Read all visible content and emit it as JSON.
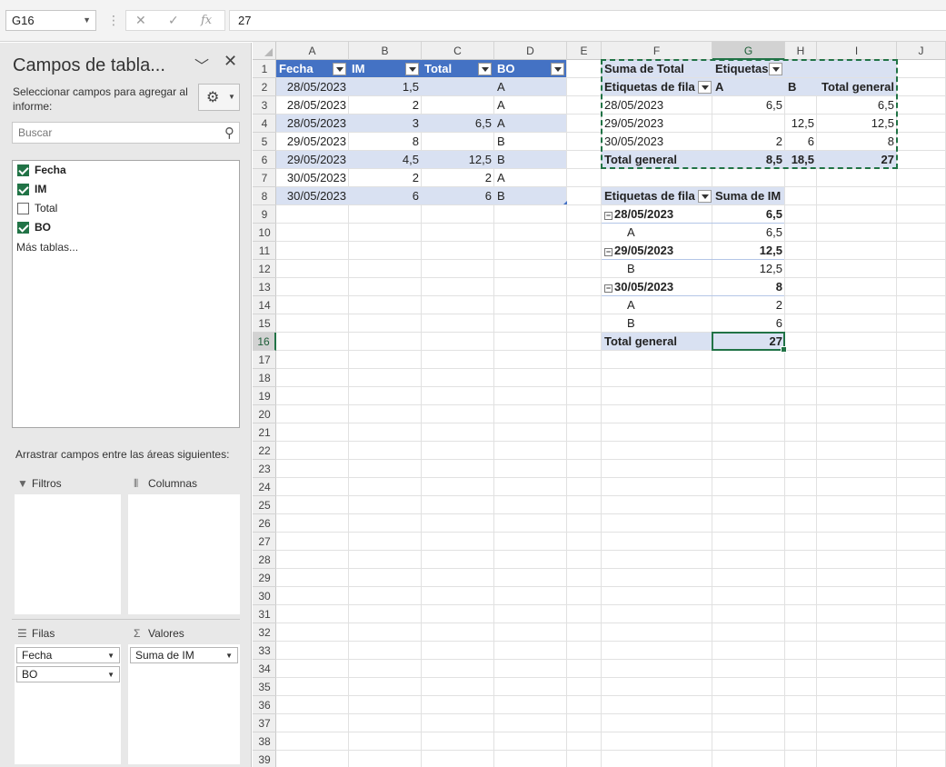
{
  "formula_bar": {
    "name_box": "G16",
    "formula": "27",
    "fx": "fx"
  },
  "pane": {
    "title": "Campos de tabla...",
    "subtitle": "Seleccionar campos para agregar al informe:",
    "search_placeholder": "Buscar",
    "fields": [
      {
        "label": "Fecha",
        "checked": true
      },
      {
        "label": "IM",
        "checked": true
      },
      {
        "label": "Total",
        "checked": false
      },
      {
        "label": "BO",
        "checked": true
      }
    ],
    "more_tables": "Más tablas...",
    "drag_hint": "Arrastrar campos entre las áreas siguientes:",
    "areas": {
      "filters": "Filtros",
      "columns": "Columnas",
      "rows": "Filas",
      "values": "Valores"
    },
    "row_fields": [
      "Fecha",
      "BO"
    ],
    "value_fields": [
      "Suma de IM"
    ]
  },
  "grid": {
    "columns": [
      "A",
      "B",
      "C",
      "D",
      "E",
      "F",
      "G",
      "H",
      "I",
      "J"
    ],
    "rows": [
      "1",
      "2",
      "3",
      "4",
      "5",
      "6",
      "7",
      "8",
      "9",
      "10",
      "11",
      "12",
      "13",
      "14",
      "15",
      "16",
      "17",
      "18",
      "19",
      "20",
      "21",
      "22",
      "23",
      "24",
      "25",
      "26",
      "27",
      "28",
      "29",
      "30",
      "31",
      "32",
      "33",
      "34",
      "35",
      "36",
      "37",
      "38",
      "39"
    ],
    "selected_column": "G",
    "selected_row": "16"
  },
  "source_table": {
    "headers": [
      "Fecha",
      "IM",
      "Total",
      "BO"
    ],
    "rows": [
      [
        "28/05/2023",
        "1,5",
        "",
        "A"
      ],
      [
        "28/05/2023",
        "2",
        "",
        "A"
      ],
      [
        "28/05/2023",
        "3",
        "6,5",
        "A"
      ],
      [
        "29/05/2023",
        "8",
        "",
        "B"
      ],
      [
        "29/05/2023",
        "4,5",
        "12,5",
        "B"
      ],
      [
        "30/05/2023",
        "2",
        "2",
        "A"
      ],
      [
        "30/05/2023",
        "6",
        "6",
        "B"
      ]
    ]
  },
  "pivot1": {
    "corner": "Suma de Total",
    "col_labels_title": "Etiquetas",
    "row_labels_title": "Etiquetas de fila",
    "col_headers": [
      "A",
      "B",
      "Total general"
    ],
    "rows": [
      [
        "28/05/2023",
        "6,5",
        "",
        "6,5"
      ],
      [
        "29/05/2023",
        "",
        "12,5",
        "12,5"
      ],
      [
        "30/05/2023",
        "2",
        "6",
        "8"
      ]
    ],
    "total": [
      "Total general",
      "8,5",
      "18,5",
      "27"
    ]
  },
  "pivot2": {
    "row_labels_title": "Etiquetas de fila",
    "value_title": "Suma de IM",
    "rows": [
      {
        "label": "28/05/2023",
        "value": "6,5",
        "group": true
      },
      {
        "label": "A",
        "value": "6,5",
        "group": false
      },
      {
        "label": "29/05/2023",
        "value": "12,5",
        "group": true
      },
      {
        "label": "B",
        "value": "12,5",
        "group": false
      },
      {
        "label": "30/05/2023",
        "value": "8",
        "group": true
      },
      {
        "label": "A",
        "value": "2",
        "group": false
      },
      {
        "label": "B",
        "value": "6",
        "group": false
      }
    ],
    "total_label": "Total general",
    "total_value": "27"
  }
}
